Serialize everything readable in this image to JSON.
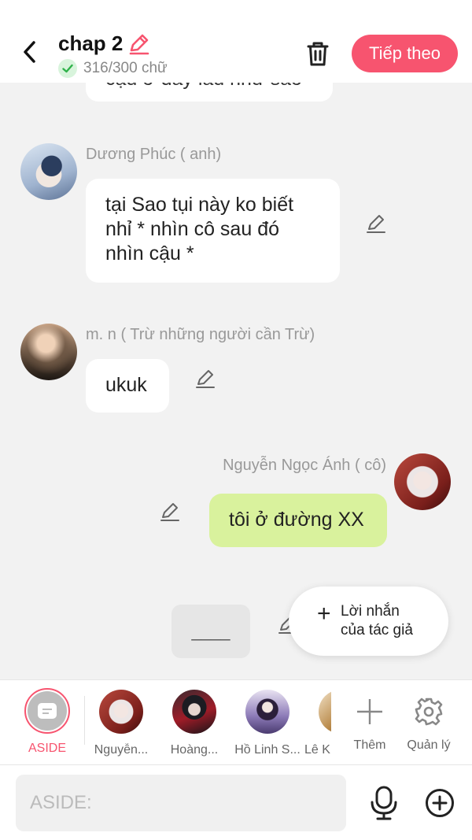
{
  "header": {
    "title": "chap 2",
    "word_count": "316/300 chữ",
    "next_label": "Tiếp theo"
  },
  "colors": {
    "accent": "#f7546f",
    "my_bubble": "#d9f29d",
    "check": "#2fb24a"
  },
  "messages": [
    {
      "sender": "",
      "text": "cậu ở đây lâu như sao"
    },
    {
      "sender": "Dương Phúc ( anh)",
      "text": "tại Sao tụi này ko biết nhỉ * nhìn cô sau đó nhìn cậu *"
    },
    {
      "sender": "m. n ( Trừ những người cần Trừ)",
      "text": "ukuk"
    },
    {
      "sender": "Nguyễn Ngọc Ánh ( cô)",
      "text": "tôi ở đường XX"
    }
  ],
  "draft_box": "____",
  "author_note": {
    "label_line1": "Lời nhắn",
    "label_line2": "của tác giả"
  },
  "characters": [
    {
      "name": "ASIDE"
    },
    {
      "name": "Nguyễn..."
    },
    {
      "name": "Hoàng..."
    },
    {
      "name": "Hồ Linh S..."
    },
    {
      "name": "Lê K"
    }
  ],
  "actions": {
    "add_label": "Thêm",
    "manage_label": "Quản lý"
  },
  "input": {
    "placeholder": "ASIDE:"
  }
}
